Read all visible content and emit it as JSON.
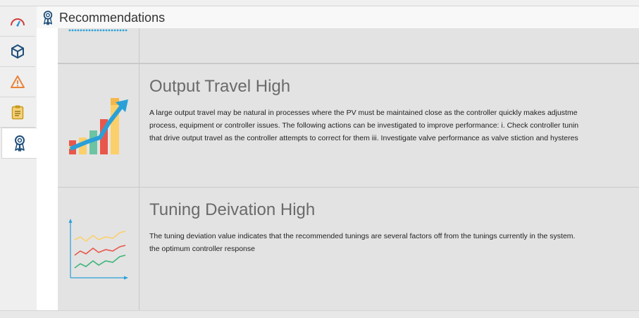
{
  "header": {
    "title": "Recommendations",
    "icon": "award-ribbon-icon"
  },
  "sidebar": {
    "items": [
      {
        "name": "gauge-icon",
        "active": false
      },
      {
        "name": "cube-icon",
        "active": false
      },
      {
        "name": "warning-icon",
        "active": false
      },
      {
        "name": "clipboard-icon",
        "active": false
      },
      {
        "name": "award-ribbon-icon",
        "active": true
      }
    ]
  },
  "recommendations": [
    {
      "title": "Output Travel High",
      "description_lines": [
        "A large output travel may be natural in processes where the PV must be maintained close as the controller quickly makes adjustme",
        "process, equipment or controller issues. The following actions can be investigated to improve performance: i. Check controller tunin",
        "that drive output travel as the controller attempts to correct for them iii. Investigate valve performance as valve stiction and hysteres"
      ],
      "icon": "growth-bar-chart-icon"
    },
    {
      "title": "Tuning Deivation High",
      "description_lines": [
        "The tuning deviation value indicates that the recommended tunings are several factors off from the tunings currently in the system.",
        "the optimum controller response"
      ],
      "icon": "line-trend-chart-icon"
    }
  ],
  "colors": {
    "accent_blue": "#1e8fd6",
    "panel_bg": "#e3e3e3",
    "title_gray": "#6a6a6a"
  }
}
